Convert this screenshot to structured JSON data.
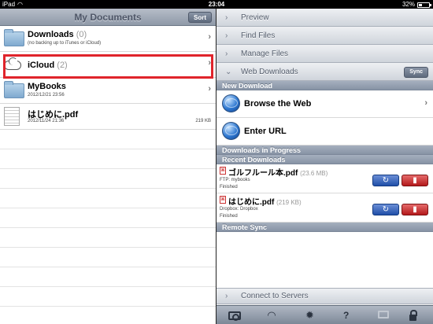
{
  "status_bar": {
    "device": "iPad",
    "time": "23:04",
    "battery": "32%"
  },
  "left_pane": {
    "title": "My Documents",
    "sort_label": "Sort",
    "items": [
      {
        "name": "Downloads",
        "count": "(0)",
        "sub": "(no backing up to iTunes or iCloud)",
        "size": "",
        "icon": "folder-icon"
      },
      {
        "name": "iCloud",
        "count": "(2)",
        "sub": "",
        "size": "",
        "icon": "cloud-icon"
      },
      {
        "name": "MyBooks",
        "count": "",
        "sub": "2012/12/21 23:56",
        "size": "",
        "icon": "folder-icon"
      },
      {
        "name": "はじめに.pdf",
        "count": "",
        "sub": "2012/11/24 21:36",
        "size": "219 KB",
        "icon": "pdf-thumbnail-icon"
      }
    ]
  },
  "right_pane": {
    "menu": [
      {
        "label": "Preview",
        "arrow": "›"
      },
      {
        "label": "Find Files",
        "arrow": "›"
      },
      {
        "label": "Manage Files",
        "arrow": "›"
      },
      {
        "label": "Web Downloads",
        "arrow": "⌄"
      }
    ],
    "sync_label": "Sync",
    "sections": {
      "new_download": "New Download",
      "in_progress": "Downloads in Progress",
      "recent": "Recent Downloads",
      "remote_sync": "Remote Sync"
    },
    "web_actions": [
      {
        "label": "Browse the Web"
      },
      {
        "label": "Enter URL"
      }
    ],
    "recent_downloads": [
      {
        "name": "ゴルフルール本.pdf",
        "size": "(23.6 MB)",
        "source": "FTP: mybooks",
        "status": "Finished"
      },
      {
        "name": "はじめに.pdf",
        "size": "(219 KB)",
        "source": "Dropbox: Dropbox",
        "status": "Finished"
      }
    ],
    "connect_label": "Connect to Servers",
    "connect_arrow": "›",
    "toolbar": {
      "icons": [
        "camera-icon",
        "wifi-icon",
        "gear-icon",
        "help-icon",
        "monitor-icon",
        "lock-icon"
      ],
      "help_glyph": "?",
      "wifi_glyph": "◠",
      "gear_glyph": "✹"
    }
  },
  "colors": {
    "highlight": "#e0242b",
    "reload": "#1f4fa8",
    "trash": "#b3191b"
  }
}
